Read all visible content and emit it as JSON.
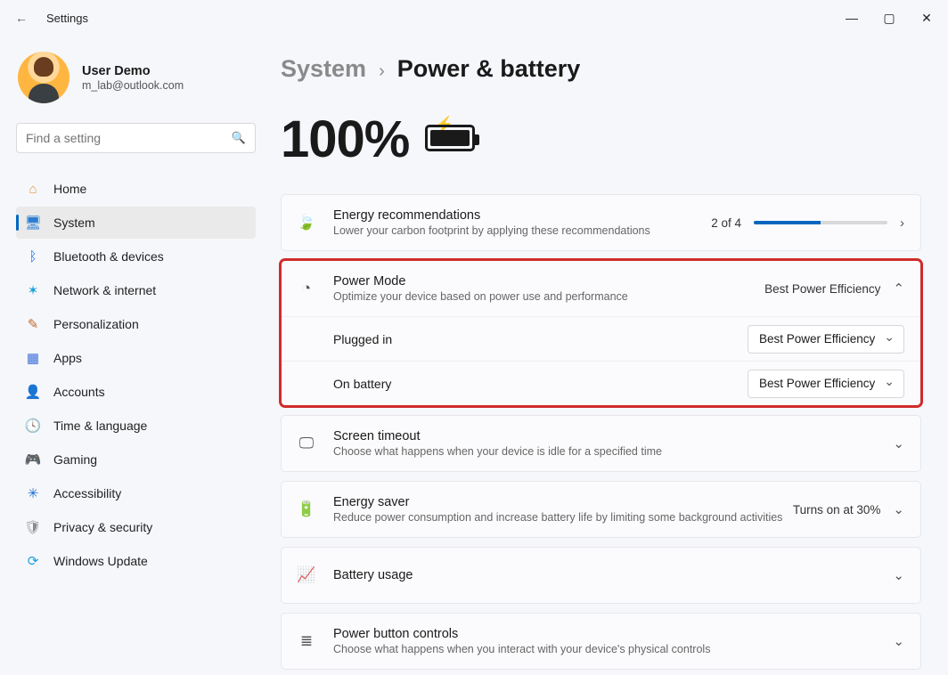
{
  "window": {
    "title": "Settings"
  },
  "profile": {
    "name": "User Demo",
    "email": "m_lab@outlook.com"
  },
  "search": {
    "placeholder": "Find a setting"
  },
  "nav": [
    {
      "label": "Home"
    },
    {
      "label": "System"
    },
    {
      "label": "Bluetooth & devices"
    },
    {
      "label": "Network & internet"
    },
    {
      "label": "Personalization"
    },
    {
      "label": "Apps"
    },
    {
      "label": "Accounts"
    },
    {
      "label": "Time & language"
    },
    {
      "label": "Gaming"
    },
    {
      "label": "Accessibility"
    },
    {
      "label": "Privacy & security"
    },
    {
      "label": "Windows Update"
    }
  ],
  "breadcrumb": {
    "root": "System",
    "leaf": "Power & battery"
  },
  "battery": {
    "percent": "100%"
  },
  "energy_rec": {
    "title": "Energy recommendations",
    "desc": "Lower your carbon footprint by applying these recommendations",
    "count": "2 of 4",
    "progress_pct": 50
  },
  "power_mode": {
    "title": "Power Mode",
    "desc": "Optimize your device based on power use and performance",
    "summary": "Best Power Efficiency",
    "plugged_label": "Plugged in",
    "plugged_value": "Best Power Efficiency",
    "battery_label": "On battery",
    "battery_value": "Best Power Efficiency"
  },
  "screen_timeout": {
    "title": "Screen timeout",
    "desc": "Choose what happens when your device is idle for a specified time"
  },
  "energy_saver": {
    "title": "Energy saver",
    "desc": "Reduce power consumption and increase battery life by limiting some background activities",
    "status": "Turns on at 30%"
  },
  "battery_usage": {
    "title": "Battery usage"
  },
  "power_button": {
    "title": "Power button controls",
    "desc": "Choose what happens when you interact with your device's physical controls"
  }
}
